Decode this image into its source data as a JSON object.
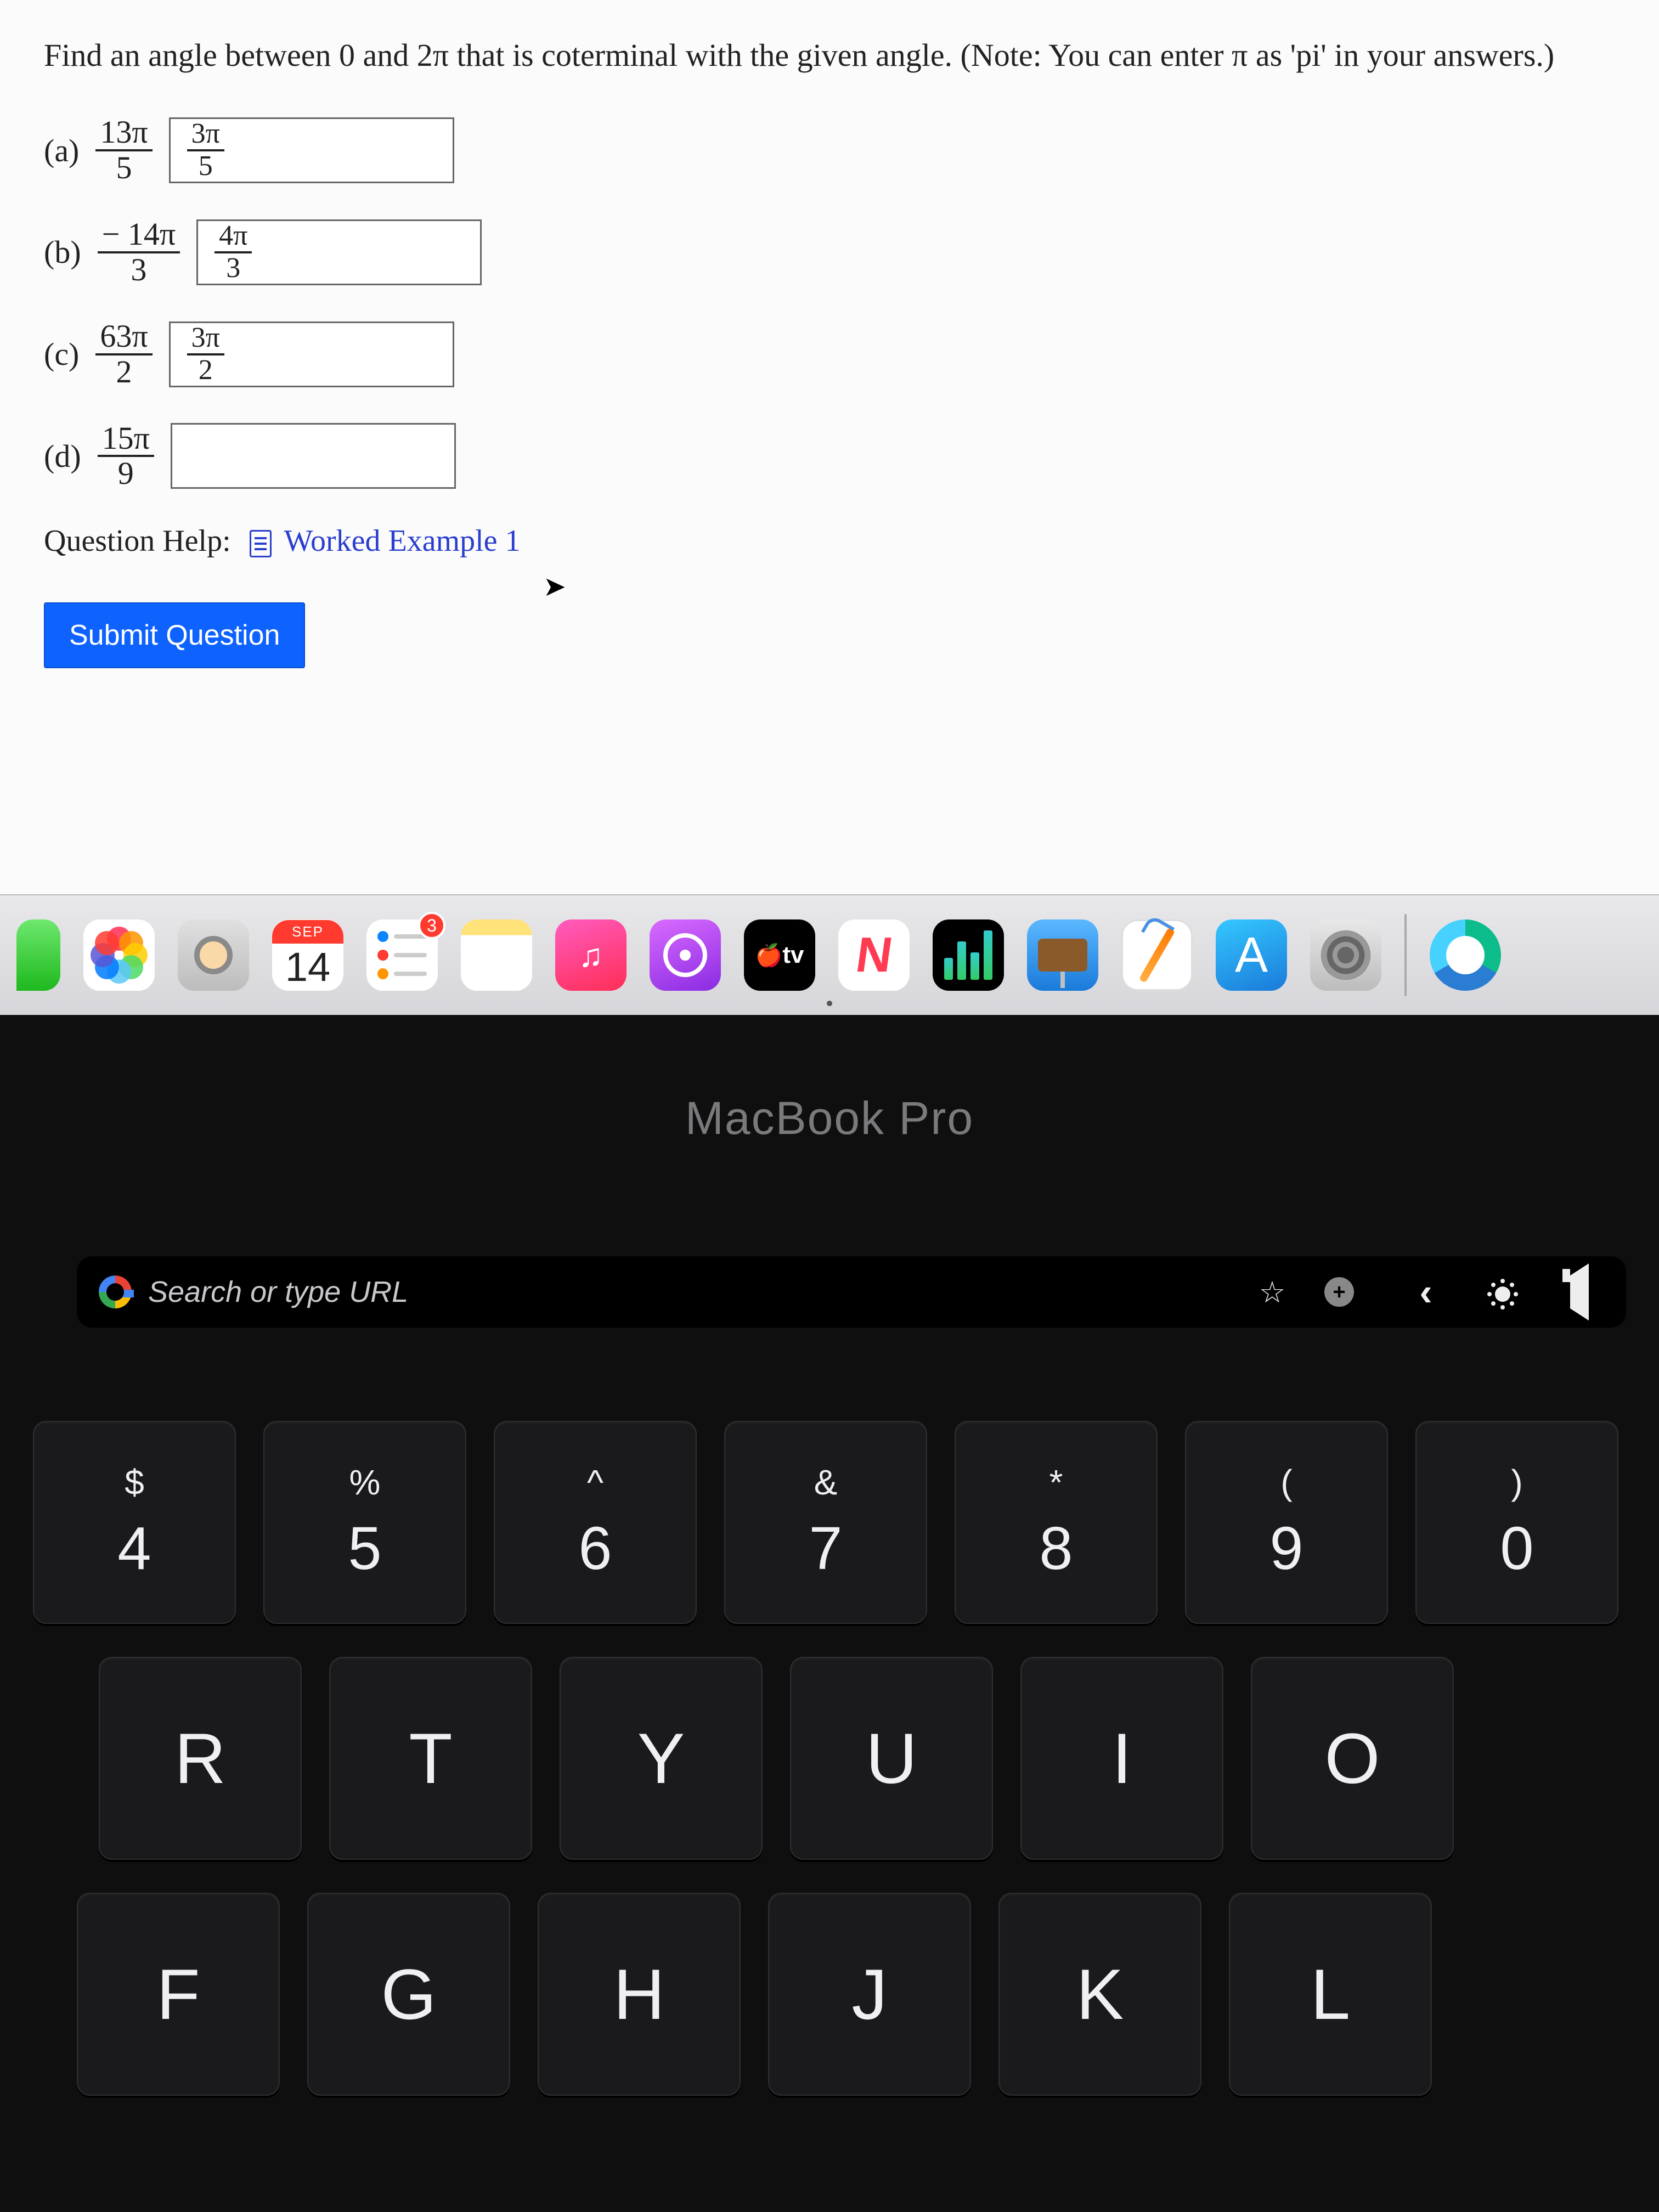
{
  "question": {
    "prompt": "Find an angle between 0 and 2π that is coterminal with the given angle. (Note: You can enter π as 'pi' in your answers.)",
    "parts": {
      "a": {
        "label": "(a)",
        "given_num": "13π",
        "given_den": "5",
        "ans_num": "3π",
        "ans_den": "5"
      },
      "b": {
        "label": "(b)",
        "given_num": "− 14π",
        "given_den": "3",
        "ans_num": "4π",
        "ans_den": "3"
      },
      "c": {
        "label": "(c)",
        "given_num": "63π",
        "given_den": "2",
        "ans_num": "3π",
        "ans_den": "2"
      },
      "d": {
        "label": "(d)",
        "given_num": "15π",
        "given_den": "9",
        "ans": ""
      }
    },
    "help_label": "Question Help:",
    "worked_link": "Worked Example 1",
    "submit": "Submit Question"
  },
  "dock": {
    "calendar_month": "SEP",
    "calendar_day": "14",
    "reminders_badge": "3",
    "tv_label": "tv"
  },
  "hardware": {
    "brand": "MacBook Pro"
  },
  "touchbar": {
    "search_placeholder": "Search or type URL"
  },
  "keys": {
    "r1": [
      {
        "sym": "$",
        "main": "4"
      },
      {
        "sym": "%",
        "main": "5"
      },
      {
        "sym": "^",
        "main": "6"
      },
      {
        "sym": "&",
        "main": "7"
      },
      {
        "sym": "*",
        "main": "8"
      },
      {
        "sym": "(",
        "main": "9"
      },
      {
        "sym": ")",
        "main": "0"
      }
    ],
    "r2": [
      "R",
      "T",
      "Y",
      "U",
      "I",
      "O"
    ],
    "r3": [
      "F",
      "G",
      "H",
      "J",
      "K",
      "L"
    ]
  }
}
